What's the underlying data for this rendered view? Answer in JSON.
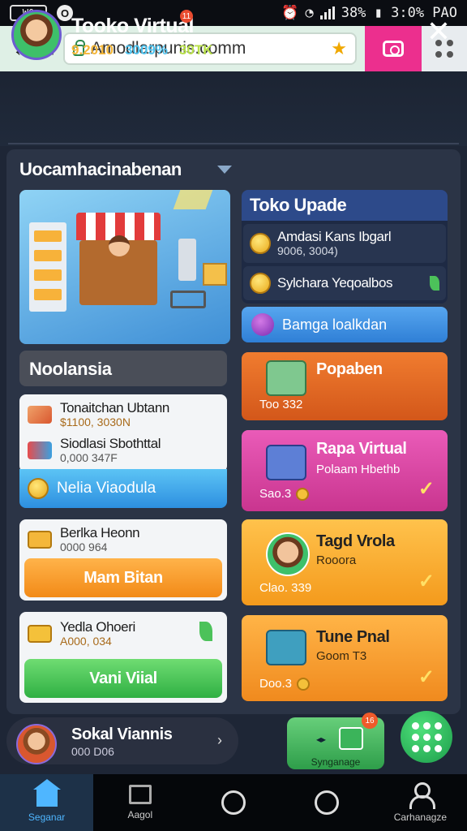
{
  "status_bar": {
    "left_box": "W0",
    "left_circle": "O",
    "right_text": "38% ▮ 3:0% PAO"
  },
  "browser": {
    "url": "Amodlarpunis.comm"
  },
  "header": {
    "title": "Tooko Virtual",
    "notif_count": "11",
    "stat1": "9.2010",
    "stat2": "3009%",
    "stat3": "30TK"
  },
  "main": {
    "section_title": "Uocamhacinabenan",
    "toko": {
      "title": "Toko Upade",
      "row1_title": "Amdasi Kans Ibgarl",
      "row1_sub": "9006, 3004)",
      "row2_title": "Sylchara Yeqoalbos",
      "action_label": "Bamga loalkdan"
    },
    "left_header": "Noolansia",
    "list": {
      "item1_title": "Tonaitchan Ubtann",
      "item1_sub": "$1100, 3030N",
      "item2_title": "Siodlasi Sbothttal",
      "item2_sub": "0,000 347F",
      "cyan_label": "Nelia Viaodula"
    },
    "card_b": {
      "title": "Berlka Heonn",
      "sub": "0000 964",
      "button": "Mam Bitan"
    },
    "card_c": {
      "title": "Yedla Ohoeri",
      "sub": "A000, 034",
      "button": "Vani Viial"
    },
    "right_cards": [
      {
        "title": "Popaben",
        "sub": "",
        "price": "Too 332"
      },
      {
        "title": "Rapa Virtual",
        "sub": "Polaam Hbethb",
        "price": "Sao.3"
      },
      {
        "title": "Tagd Vrola",
        "sub": "Rooora",
        "price": "Clao. 339"
      },
      {
        "title": "Tune Pnal",
        "sub": "Goom T3",
        "price": "Doo.3"
      }
    ]
  },
  "bottom": {
    "profile_name": "Sokal Viannis",
    "profile_sub": "000 D06",
    "sync_badge": "16",
    "sync_label": "Synganage"
  },
  "nav": {
    "items": [
      "Seganar",
      "Aagol",
      "",
      "",
      "Carhanagze"
    ]
  },
  "colors": {
    "accent_pink": "#ec2f8e",
    "accent_blue": "#4fb6ff",
    "orange": "#f28a17",
    "green": "#2fb043",
    "magenta_card": "#e04aa8"
  }
}
